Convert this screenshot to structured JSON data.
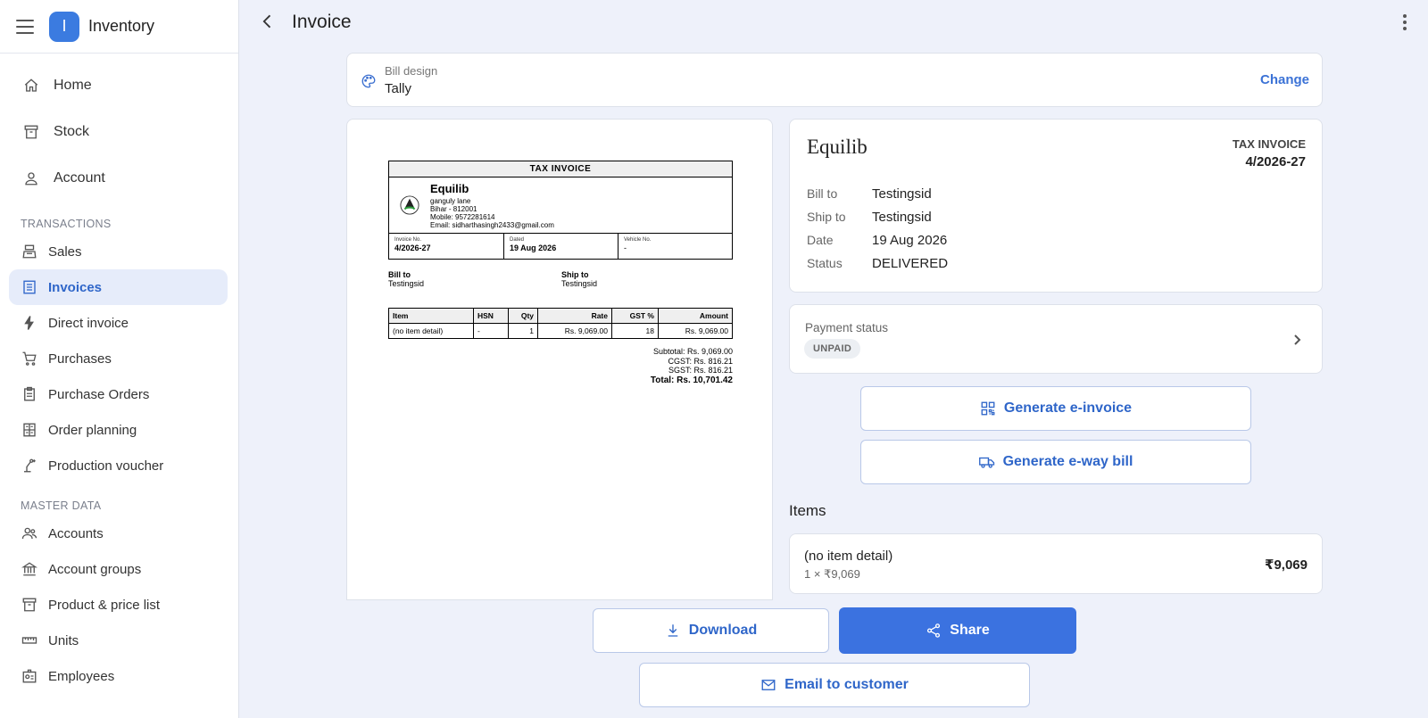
{
  "app": {
    "logo_letter": "I",
    "name": "Inventory"
  },
  "sidebar": {
    "main": [
      {
        "label": "Home",
        "icon": "home-icon"
      },
      {
        "label": "Stock",
        "icon": "archive-icon"
      },
      {
        "label": "Account",
        "icon": "user-icon"
      }
    ],
    "transactions_label": "TRANSACTIONS",
    "transactions": [
      {
        "label": "Sales",
        "icon": "register-icon"
      },
      {
        "label": "Invoices",
        "icon": "list-icon",
        "active": true
      },
      {
        "label": "Direct invoice",
        "icon": "bolt-icon"
      },
      {
        "label": "Purchases",
        "icon": "cart-icon"
      },
      {
        "label": "Purchase Orders",
        "icon": "clipboard-icon"
      },
      {
        "label": "Order planning",
        "icon": "calculator-icon"
      },
      {
        "label": "Production voucher",
        "icon": "robot-arm-icon"
      }
    ],
    "master_label": "MASTER DATA",
    "master": [
      {
        "label": "Accounts",
        "icon": "users-icon"
      },
      {
        "label": "Account groups",
        "icon": "bank-icon"
      },
      {
        "label": "Product & price list",
        "icon": "archive-icon"
      },
      {
        "label": "Units",
        "icon": "ruler-icon"
      },
      {
        "label": "Employees",
        "icon": "badge-icon"
      }
    ]
  },
  "header": {
    "title": "Invoice"
  },
  "bill_design": {
    "label": "Bill design",
    "value": "Tally",
    "change": "Change"
  },
  "preview": {
    "title": "TAX INVOICE",
    "company": "Equilib",
    "address1": "ganguly lane",
    "address2": "Bihar - 812001",
    "mobile": "Mobile: 9572281614",
    "email": "Email: sidharthasingh2433@gmail.com",
    "invoice_no_label": "Invoice No.",
    "invoice_no": "4/2026-27",
    "dated_label": "Dated",
    "dated": "19 Aug 2026",
    "vehicle_label": "Vehicle No.",
    "vehicle": "-",
    "bill_to_label": "Bill to",
    "bill_to": "Testingsid",
    "ship_to_label": "Ship to",
    "ship_to": "Testingsid",
    "columns": [
      "Item",
      "HSN",
      "Qty",
      "Rate",
      "GST %",
      "Amount"
    ],
    "rows": [
      [
        "(no item detail)",
        "-",
        "1",
        "Rs. 9,069.00",
        "18",
        "Rs. 9,069.00"
      ]
    ],
    "subtotal": "Subtotal: Rs. 9,069.00",
    "cgst": "CGST: Rs. 816.21",
    "sgst": "SGST: Rs. 816.21",
    "total": "Total: Rs. 10,701.42"
  },
  "summary": {
    "company": "Equilib",
    "doc_type": "TAX INVOICE",
    "doc_number": "4/2026-27",
    "bill_to_label": "Bill to",
    "bill_to": "Testingsid",
    "ship_to_label": "Ship to",
    "ship_to": "Testingsid",
    "date_label": "Date",
    "date": "19 Aug 2026",
    "status_label": "Status",
    "status": "DELIVERED"
  },
  "payment": {
    "label": "Payment status",
    "badge": "UNPAID"
  },
  "actions": {
    "einvoice": "Generate e-invoice",
    "eway": "Generate e-way bill",
    "download": "Download",
    "share": "Share",
    "email": "Email to customer"
  },
  "items": {
    "heading": "Items",
    "list": [
      {
        "name": "(no item detail)",
        "sub": "1 × ₹9,069",
        "amount": "₹9,069"
      }
    ]
  },
  "colors": {
    "accent": "#3b72e0",
    "active_bg": "#e6ecfa",
    "page_bg": "#eef1fa"
  }
}
